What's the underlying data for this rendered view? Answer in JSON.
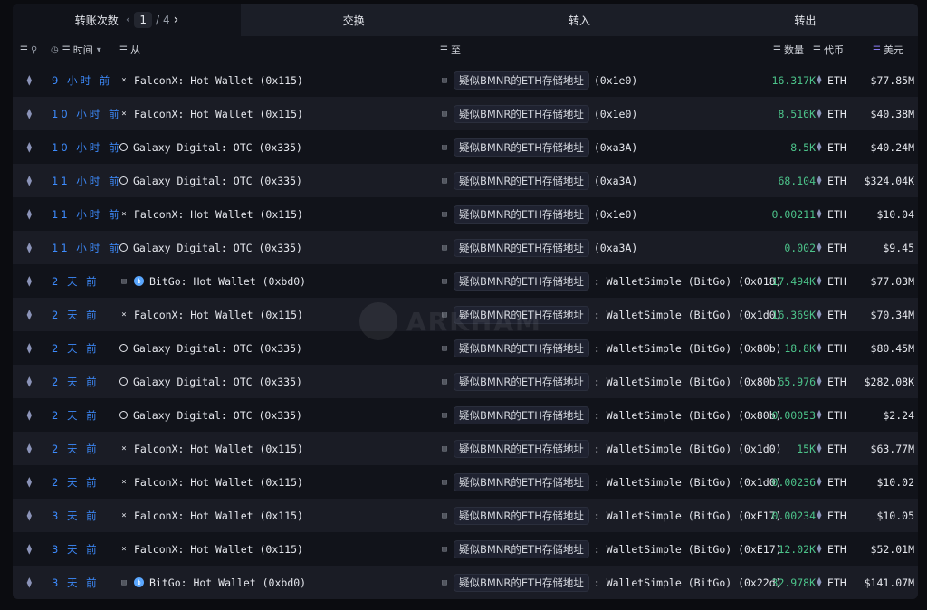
{
  "tabs": {
    "transfers_label": "转账次数",
    "page_current": "1",
    "page_sep": "/",
    "page_total": "4",
    "swaps_label": "交换",
    "inflow_label": "转入",
    "outflow_label": "转出"
  },
  "columns": {
    "time": "时间",
    "from": "从",
    "to": "至",
    "amount": "数量",
    "token": "代币",
    "usd": "美元"
  },
  "watermark": "ARKHAM",
  "rows": [
    {
      "time": "9 小时 前",
      "from": "FalconX: Hot Wallet (0x115)",
      "from_icon": "falconx-icon",
      "to_tag": "疑似BMNR的ETH存储地址",
      "to_addr": "(0x1e0)",
      "amount": "16.317K",
      "token": "ETH",
      "usd": "$77.85M"
    },
    {
      "time": "10 小时 前",
      "from": "FalconX: Hot Wallet (0x115)",
      "from_icon": "falconx-icon",
      "to_tag": "疑似BMNR的ETH存储地址",
      "to_addr": "(0x1e0)",
      "amount": "8.516K",
      "token": "ETH",
      "usd": "$40.38M"
    },
    {
      "time": "10 小时 前",
      "from": "Galaxy Digital: OTC (0x335)",
      "from_icon": "galaxy-icon",
      "to_tag": "疑似BMNR的ETH存储地址",
      "to_addr": "(0xa3A)",
      "amount": "8.5K",
      "token": "ETH",
      "usd": "$40.24M"
    },
    {
      "time": "11 小时 前",
      "from": "Galaxy Digital: OTC (0x335)",
      "from_icon": "galaxy-icon",
      "to_tag": "疑似BMNR的ETH存储地址",
      "to_addr": "(0xa3A)",
      "amount": "68.104",
      "token": "ETH",
      "usd": "$324.04K"
    },
    {
      "time": "11 小时 前",
      "from": "FalconX: Hot Wallet (0x115)",
      "from_icon": "falconx-icon",
      "to_tag": "疑似BMNR的ETH存储地址",
      "to_addr": "(0x1e0)",
      "amount": "0.00211",
      "token": "ETH",
      "usd": "$10.04"
    },
    {
      "time": "11 小时 前",
      "from": "Galaxy Digital: OTC (0x335)",
      "from_icon": "galaxy-icon",
      "to_tag": "疑似BMNR的ETH存储地址",
      "to_addr": "(0xa3A)",
      "amount": "0.002",
      "token": "ETH",
      "usd": "$9.45"
    },
    {
      "time": "2 天 前",
      "from": "BitGo: Hot Wallet (0xbd0)",
      "from_icon": "bitgo-icon",
      "to_tag": "疑似BMNR的ETH存储地址",
      "to_addr": ": WalletSimple (BitGo) (0x018)",
      "amount": "17.494K",
      "token": "ETH",
      "usd": "$77.03M"
    },
    {
      "time": "2 天 前",
      "from": "FalconX: Hot Wallet (0x115)",
      "from_icon": "falconx-icon",
      "to_tag": "疑似BMNR的ETH存储地址",
      "to_addr": ": WalletSimple (BitGo) (0x1d0)",
      "amount": "16.369K",
      "token": "ETH",
      "usd": "$70.34M"
    },
    {
      "time": "2 天 前",
      "from": "Galaxy Digital: OTC (0x335)",
      "from_icon": "galaxy-icon",
      "to_tag": "疑似BMNR的ETH存储地址",
      "to_addr": ": WalletSimple (BitGo) (0x80b)",
      "amount": "18.8K",
      "token": "ETH",
      "usd": "$80.45M"
    },
    {
      "time": "2 天 前",
      "from": "Galaxy Digital: OTC (0x335)",
      "from_icon": "galaxy-icon",
      "to_tag": "疑似BMNR的ETH存储地址",
      "to_addr": ": WalletSimple (BitGo) (0x80b)",
      "amount": "65.976",
      "token": "ETH",
      "usd": "$282.08K"
    },
    {
      "time": "2 天 前",
      "from": "Galaxy Digital: OTC (0x335)",
      "from_icon": "galaxy-icon",
      "to_tag": "疑似BMNR的ETH存储地址",
      "to_addr": ": WalletSimple (BitGo) (0x80b)",
      "amount": "0.00053",
      "token": "ETH",
      "usd": "$2.24"
    },
    {
      "time": "2 天 前",
      "from": "FalconX: Hot Wallet (0x115)",
      "from_icon": "falconx-icon",
      "to_tag": "疑似BMNR的ETH存储地址",
      "to_addr": ": WalletSimple (BitGo) (0x1d0)",
      "amount": "15K",
      "token": "ETH",
      "usd": "$63.77M"
    },
    {
      "time": "2 天 前",
      "from": "FalconX: Hot Wallet (0x115)",
      "from_icon": "falconx-icon",
      "to_tag": "疑似BMNR的ETH存储地址",
      "to_addr": ": WalletSimple (BitGo) (0x1d0)",
      "amount": "0.00236",
      "token": "ETH",
      "usd": "$10.02"
    },
    {
      "time": "3 天 前",
      "from": "FalconX: Hot Wallet (0x115)",
      "from_icon": "falconx-icon",
      "to_tag": "疑似BMNR的ETH存储地址",
      "to_addr": ": WalletSimple (BitGo) (0xE17)",
      "amount": "0.00234",
      "token": "ETH",
      "usd": "$10.05"
    },
    {
      "time": "3 天 前",
      "from": "FalconX: Hot Wallet (0x115)",
      "from_icon": "falconx-icon",
      "to_tag": "疑似BMNR的ETH存储地址",
      "to_addr": ": WalletSimple (BitGo) (0xE17)",
      "amount": "12.02K",
      "token": "ETH",
      "usd": "$52.01M"
    },
    {
      "time": "3 天 前",
      "from": "BitGo: Hot Wallet (0xbd0)",
      "from_icon": "bitgo-icon",
      "to_tag": "疑似BMNR的ETH存储地址",
      "to_addr": ": WalletSimple (BitGo) (0x22d)",
      "amount": "32.978K",
      "token": "ETH",
      "usd": "$141.07M"
    }
  ]
}
